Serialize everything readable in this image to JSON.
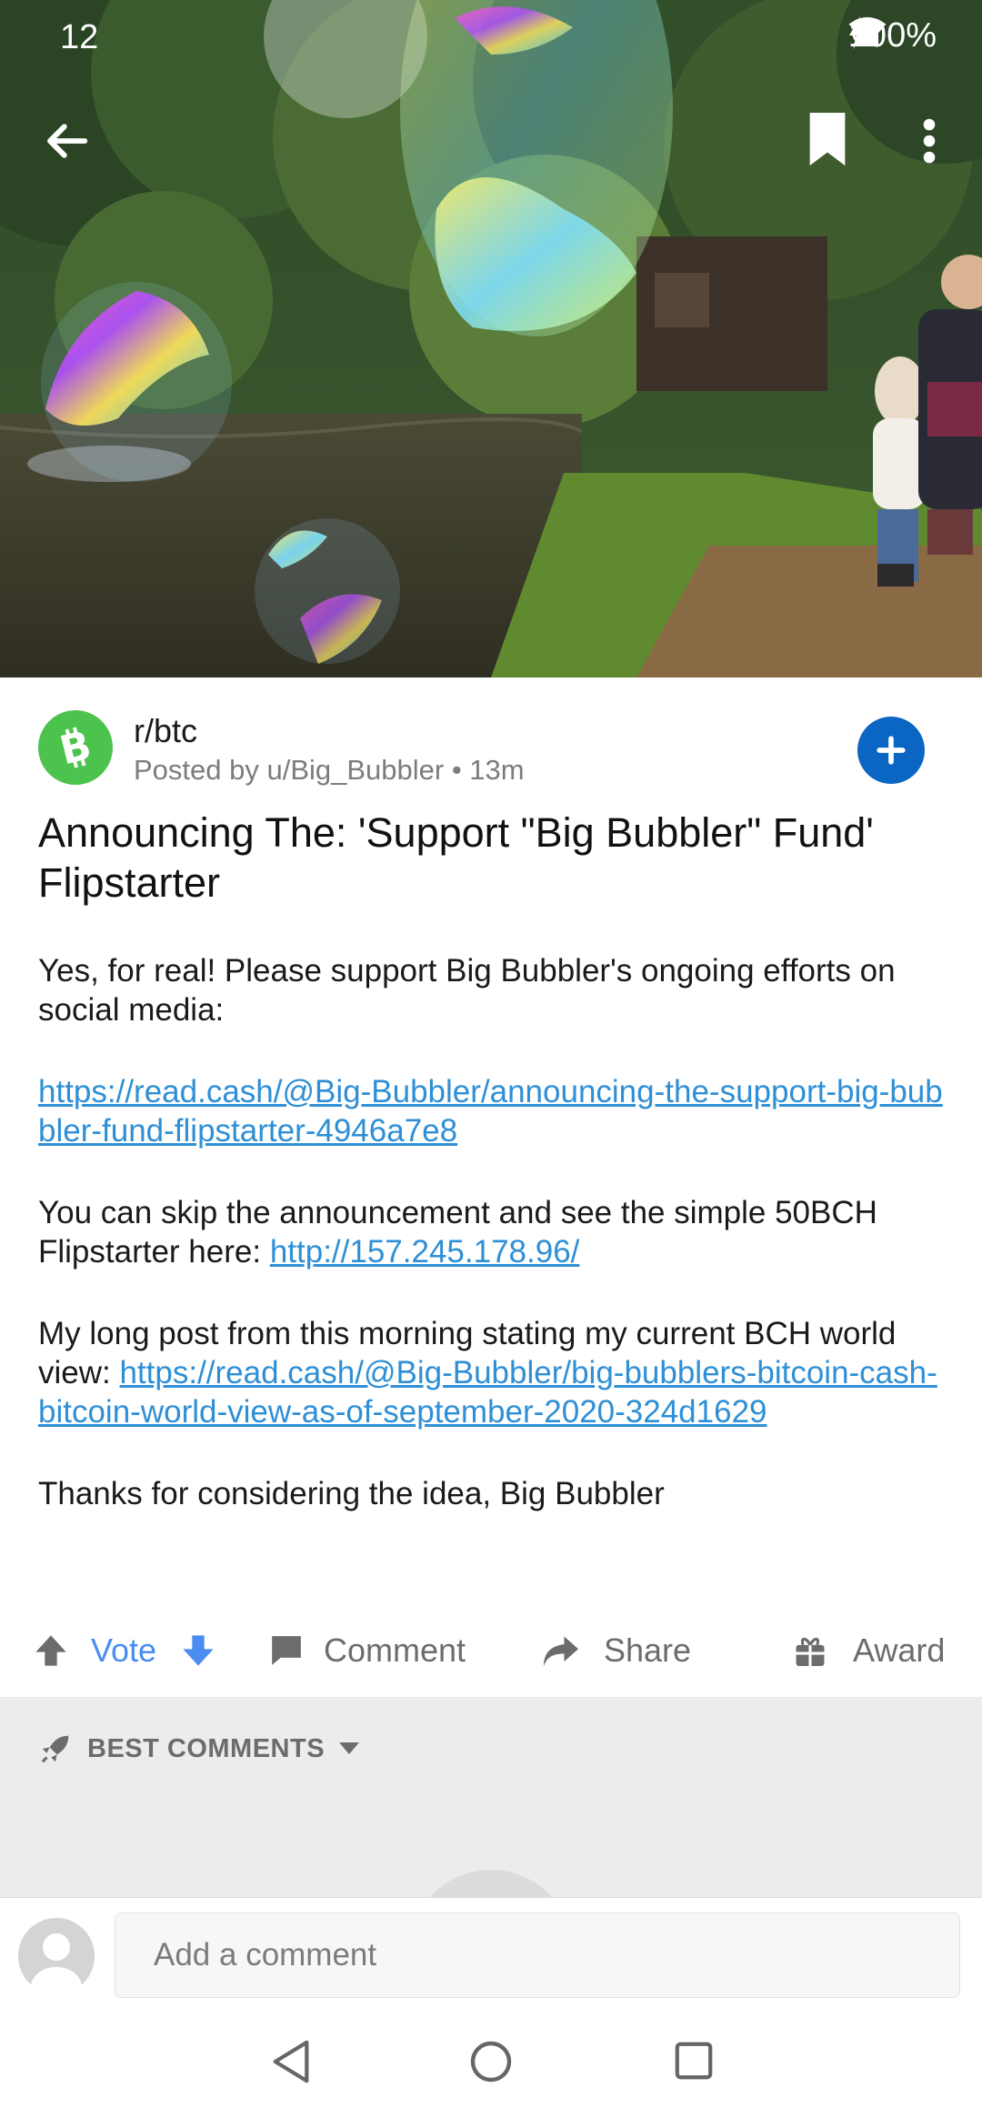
{
  "status_bar": {
    "time": "12",
    "battery": "100%"
  },
  "post": {
    "subreddit": "r/btc",
    "posted_by": "Posted by u/Big_Bubbler • 13m",
    "title": "Announcing The: 'Support \"Big Bubbler\" Fund' Flipstarter",
    "body": {
      "p1": "Yes, for real! Please support Big Bubbler's ongoing efforts on social media:",
      "link1": "https://read.cash/@Big-Bubbler/announcing-the-support-big-bubbler-fund-flipstarter-4946a7e8",
      "p3_text": "You can skip the announcement and see the simple 50BCH Flipstarter here: ",
      "link2": "http://157.245.178.96/",
      "p4_text": "My long post from this morning stating my current BCH world view: ",
      "link3": "https://read.cash/@Big-Bubbler/big-bubblers-bitcoin-cash-bitcoin-world-view-as-of-september-2020-324d1629",
      "p5": "Thanks for considering the idea, Big Bubbler"
    }
  },
  "actions": {
    "vote": "Vote",
    "comment": "Comment",
    "share": "Share",
    "award": "Award"
  },
  "comments": {
    "sort_label": "BEST COMMENTS"
  },
  "comment_input": {
    "placeholder": "Add a comment"
  },
  "colors": {
    "accent": "#0a66c2",
    "link": "#2e8fd6",
    "vote": "#4a8cf0",
    "sub_icon": "#4cc34c"
  }
}
